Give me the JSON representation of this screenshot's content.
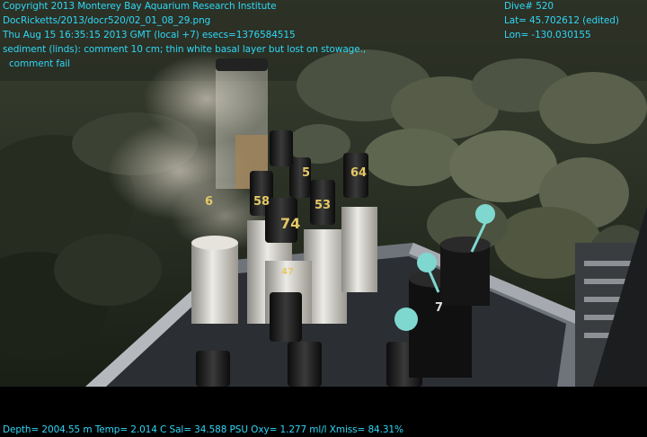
{
  "overlay": {
    "copyright": "Copyright 2013 Monterey Bay Aquarium Research Institute",
    "image_path": "DocRicketts/2013/docr520/02_01_08_29.png",
    "timestamp": "Thu Aug 15 16:35:15 2013 GMT (local +7)  esecs=1376584515",
    "comment_line1": "sediment (linds): comment 10 cm; thin white basal layer but lost on stowage.,",
    "comment_line2": "comment fail",
    "dive": "Dive# 520",
    "lat": "Lat= 45.702612 (edited)",
    "lon": "Lon= -130.030155",
    "telemetry": "Depth= 2004.55 m  Temp= 2.014 C  Sal= 34.588 PSU  Oxy= 1.277 ml/l  Xmiss= 84.31%"
  },
  "core_labels": [
    "6",
    "5",
    "58",
    "53",
    "64",
    "74",
    "47",
    "7"
  ],
  "colors": {
    "overlay_text": "#2fd7f5",
    "seafloor_dark": "#1d2419",
    "seafloor_light": "#5b6347",
    "sediment_plume": "#b7b0a3",
    "core_tube": "#d9d6cf",
    "rack_metal": "#a6aab0",
    "anemone": "#7fd8d0"
  }
}
